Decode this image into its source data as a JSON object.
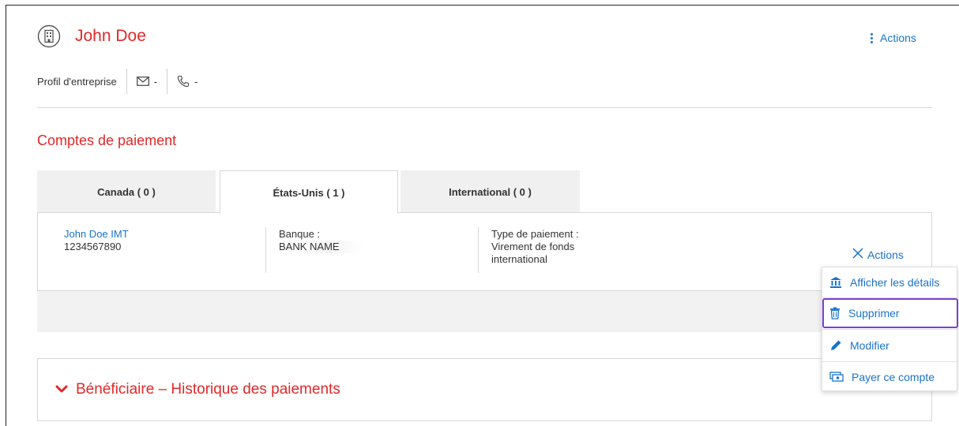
{
  "header": {
    "title": "John Doe",
    "icon": "building-icon",
    "actions_label": "Actions",
    "profile_type": "Profil d'entreprise",
    "email_value": "-",
    "phone_value": "-"
  },
  "payment_accounts": {
    "section_title": "Comptes de paiement",
    "tabs": [
      {
        "label": "Canada ( 0 )",
        "active": false
      },
      {
        "label": "États-Unis ( 1 )",
        "active": true
      },
      {
        "label": "International ( 0 )",
        "active": false
      }
    ],
    "account": {
      "name": "John Doe IMT",
      "number": "1234567890",
      "bank_label": "Banque :",
      "bank_name": "BANK NAME",
      "payment_type_label": "Type de paiement :",
      "payment_type_line1": "Virement de fonds",
      "payment_type_line2": "international",
      "actions_label": "Actions"
    }
  },
  "actions_menu": {
    "items": [
      {
        "label": "Afficher les détails",
        "icon": "bank-icon"
      },
      {
        "label": "Supprimer",
        "icon": "trash-icon",
        "selected": true
      },
      {
        "label": "Modifier",
        "icon": "pencil-icon"
      },
      {
        "label": "Payer ce compte",
        "icon": "money-icon"
      }
    ]
  },
  "history": {
    "title": "Bénéficiaire – Historique des paiements"
  },
  "colors": {
    "brand_red": "#e22828",
    "link_blue": "#1a73c8",
    "selection_purple": "#7b3fd0"
  }
}
